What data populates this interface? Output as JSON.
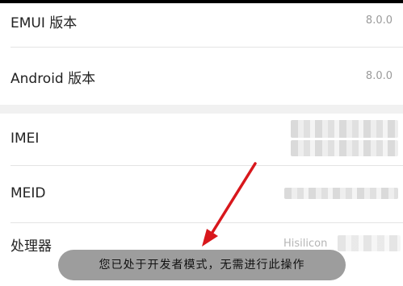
{
  "about": {
    "emui_label": "EMUI 版本",
    "emui_value": "8.0.0",
    "android_label": "Android 版本",
    "android_value": "8.0.0",
    "imei_label": "IMEI",
    "meid_label": "MEID",
    "processor_label": "处理器",
    "processor_value_partial": "Hisilicon"
  },
  "toast": {
    "message": "您已处于开发者模式，无需进行此操作"
  },
  "colors": {
    "annotation_arrow": "#d8171c",
    "toast_bg": "#9d9d9d"
  }
}
